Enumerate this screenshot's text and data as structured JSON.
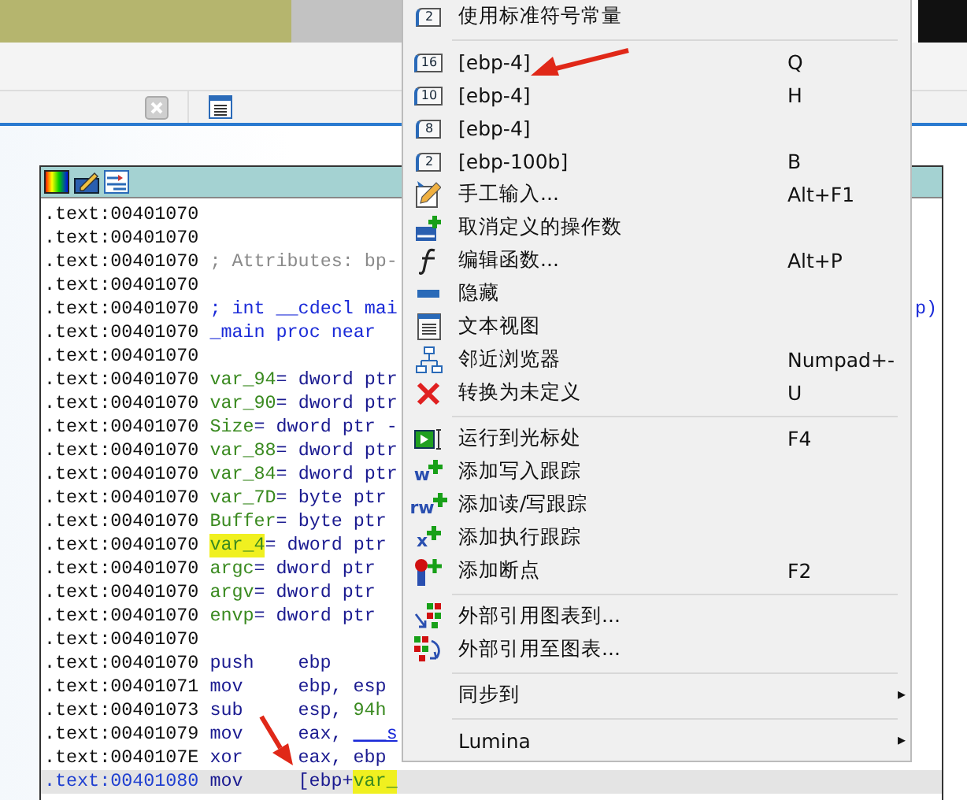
{
  "code_window": {
    "lines": [
      {
        "addr": ".text:00401070",
        "selected": false
      },
      {
        "addr": ".text:00401070",
        "selected": false
      },
      {
        "addr": ".text:00401070",
        "parts": [
          {
            "t": "; Attributes: bp-",
            "kind": "comment"
          }
        ],
        "selected": false
      },
      {
        "addr": ".text:00401070",
        "selected": false
      },
      {
        "addr": ".text:00401070",
        "parts": [
          {
            "t": "; int __cdecl mai",
            "kind": "decl"
          }
        ],
        "tail": "p)",
        "selected": false
      },
      {
        "addr": ".text:00401070",
        "parts": [
          {
            "t": "_main proc near",
            "kind": "decl"
          }
        ],
        "selected": false
      },
      {
        "addr": ".text:00401070",
        "selected": false
      },
      {
        "addr": ".text:00401070",
        "parts": [
          {
            "t": "var_94",
            "kind": "name"
          },
          {
            "t": "= dword ptr",
            "kind": "type"
          }
        ],
        "selected": false
      },
      {
        "addr": ".text:00401070",
        "parts": [
          {
            "t": "var_90",
            "kind": "name"
          },
          {
            "t": "= dword ptr",
            "kind": "type"
          }
        ],
        "selected": false
      },
      {
        "addr": ".text:00401070",
        "parts": [
          {
            "t": "Size",
            "kind": "name"
          },
          {
            "t": "= dword ptr -",
            "kind": "type"
          }
        ],
        "selected": false
      },
      {
        "addr": ".text:00401070",
        "parts": [
          {
            "t": "var_88",
            "kind": "name"
          },
          {
            "t": "= dword ptr",
            "kind": "type"
          }
        ],
        "selected": false
      },
      {
        "addr": ".text:00401070",
        "parts": [
          {
            "t": "var_84",
            "kind": "name"
          },
          {
            "t": "= dword ptr",
            "kind": "type"
          }
        ],
        "selected": false
      },
      {
        "addr": ".text:00401070",
        "parts": [
          {
            "t": "var_7D",
            "kind": "name"
          },
          {
            "t": "= byte ptr",
            "kind": "type"
          }
        ],
        "selected": false
      },
      {
        "addr": ".text:00401070",
        "parts": [
          {
            "t": "Buffer",
            "kind": "name"
          },
          {
            "t": "= byte ptr",
            "kind": "type"
          }
        ],
        "selected": false
      },
      {
        "addr": ".text:00401070",
        "parts": [
          {
            "t": "var_4",
            "kind": "mark"
          },
          {
            "t": "= dword ptr",
            "kind": "type"
          }
        ],
        "selected": false
      },
      {
        "addr": ".text:00401070",
        "parts": [
          {
            "t": "argc",
            "kind": "name"
          },
          {
            "t": "= dword ptr",
            "kind": "type"
          }
        ],
        "selected": false
      },
      {
        "addr": ".text:00401070",
        "parts": [
          {
            "t": "argv",
            "kind": "name"
          },
          {
            "t": "= dword ptr",
            "kind": "type"
          }
        ],
        "selected": false
      },
      {
        "addr": ".text:00401070",
        "parts": [
          {
            "t": "envp",
            "kind": "name"
          },
          {
            "t": "= dword ptr",
            "kind": "type"
          }
        ],
        "selected": false
      },
      {
        "addr": ".text:00401070",
        "selected": false
      },
      {
        "addr": ".text:00401070",
        "parts": [
          {
            "t": "push",
            "kind": "instr"
          },
          {
            "t": "ebp",
            "kind": "reg"
          }
        ],
        "selected": false
      },
      {
        "addr": ".text:00401071",
        "parts": [
          {
            "t": "mov",
            "kind": "instr"
          },
          {
            "t": "ebp, esp",
            "kind": "reg"
          }
        ],
        "selected": false
      },
      {
        "addr": ".text:00401073",
        "parts": [
          {
            "t": "sub",
            "kind": "instr"
          },
          {
            "t": "esp, ",
            "kind": "reg"
          },
          {
            "t": "94h",
            "kind": "num"
          }
        ],
        "selected": false
      },
      {
        "addr": ".text:00401079",
        "parts": [
          {
            "t": "mov",
            "kind": "instr"
          },
          {
            "t": "eax, ",
            "kind": "reg"
          },
          {
            "t": "___s",
            "kind": "link"
          }
        ],
        "selected": false
      },
      {
        "addr": ".text:0040107E",
        "parts": [
          {
            "t": "xor",
            "kind": "instr"
          },
          {
            "t": "eax, ebp",
            "kind": "reg"
          }
        ],
        "selected": false
      },
      {
        "addr": ".text:00401080",
        "parts": [
          {
            "t": "mov",
            "kind": "instr"
          },
          {
            "t": "[ebp+",
            "kind": "reg"
          },
          {
            "t": "var_",
            "kind": "mark"
          }
        ],
        "selected": true
      }
    ]
  },
  "context_menu": {
    "items": [
      {
        "kind": "item",
        "icon_label": "2",
        "label": "使用标准符号常量"
      },
      {
        "kind": "separator"
      },
      {
        "kind": "item",
        "icon_label": "16",
        "label": "[ebp-4]",
        "shortcut": "Q"
      },
      {
        "kind": "item",
        "icon_label": "10",
        "label": "[ebp-4]",
        "shortcut": "H"
      },
      {
        "kind": "item",
        "icon_label": "8",
        "label": "[ebp-4]"
      },
      {
        "kind": "item",
        "icon_label": "2",
        "label": "[ebp-100b]",
        "shortcut": "B"
      },
      {
        "kind": "item",
        "label": "手工输入...",
        "shortcut": "Alt+F1"
      },
      {
        "kind": "item",
        "label": "取消定义的操作数"
      },
      {
        "kind": "item",
        "label": "编辑函数...",
        "shortcut": "Alt+P"
      },
      {
        "kind": "item",
        "label": "隐藏"
      },
      {
        "kind": "item",
        "label": "文本视图"
      },
      {
        "kind": "item",
        "label": "邻近浏览器",
        "shortcut": "Numpad+-"
      },
      {
        "kind": "item",
        "label": "转换为未定义",
        "shortcut": "U"
      },
      {
        "kind": "separator"
      },
      {
        "kind": "item",
        "label": "运行到光标处",
        "shortcut": "F4"
      },
      {
        "kind": "item",
        "icon_label": "w",
        "label": "添加写入跟踪"
      },
      {
        "kind": "item",
        "icon_label": "rw",
        "label": "添加读/写跟踪"
      },
      {
        "kind": "item",
        "icon_label": "x",
        "label": "添加执行跟踪"
      },
      {
        "kind": "item",
        "label": "添加断点",
        "shortcut": "F2"
      },
      {
        "kind": "separator"
      },
      {
        "kind": "item",
        "label": "外部引用图表到..."
      },
      {
        "kind": "item",
        "label": "外部引用至图表..."
      },
      {
        "kind": "separator"
      },
      {
        "kind": "item",
        "label": "同步到",
        "submenu": "▸"
      },
      {
        "kind": "separator"
      },
      {
        "kind": "item",
        "label": "Lumina",
        "submenu": "▸"
      }
    ]
  }
}
